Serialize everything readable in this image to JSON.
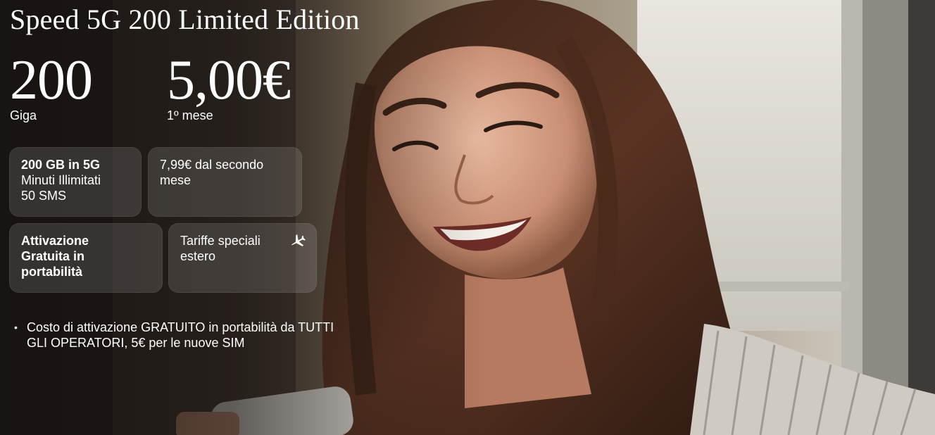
{
  "offer": {
    "title": "Speed 5G 200 Limited Edition",
    "giga_value": "200",
    "giga_label": "Giga",
    "price_value": "5,00€",
    "price_label": "1º mese"
  },
  "cards": {
    "bundle": {
      "line1": "200 GB in 5G",
      "line2": "Minuti Illimitati",
      "line3": "50 SMS"
    },
    "renewal": {
      "text": "7,99€ dal secondo mese"
    },
    "activation": {
      "text": "Attivazione Gratuita in portabilità"
    },
    "abroad": {
      "text": "Tariffe speciali estero",
      "icon": "airplane-icon"
    }
  },
  "notes": [
    "Costo di attivazione GRATUITO in portabilità da TUTTI GLI OPERATORI, 5€ per le nuove SIM"
  ],
  "colors": {
    "text": "#ffffff",
    "card_bg": "rgba(255,255,255,0.13)"
  }
}
